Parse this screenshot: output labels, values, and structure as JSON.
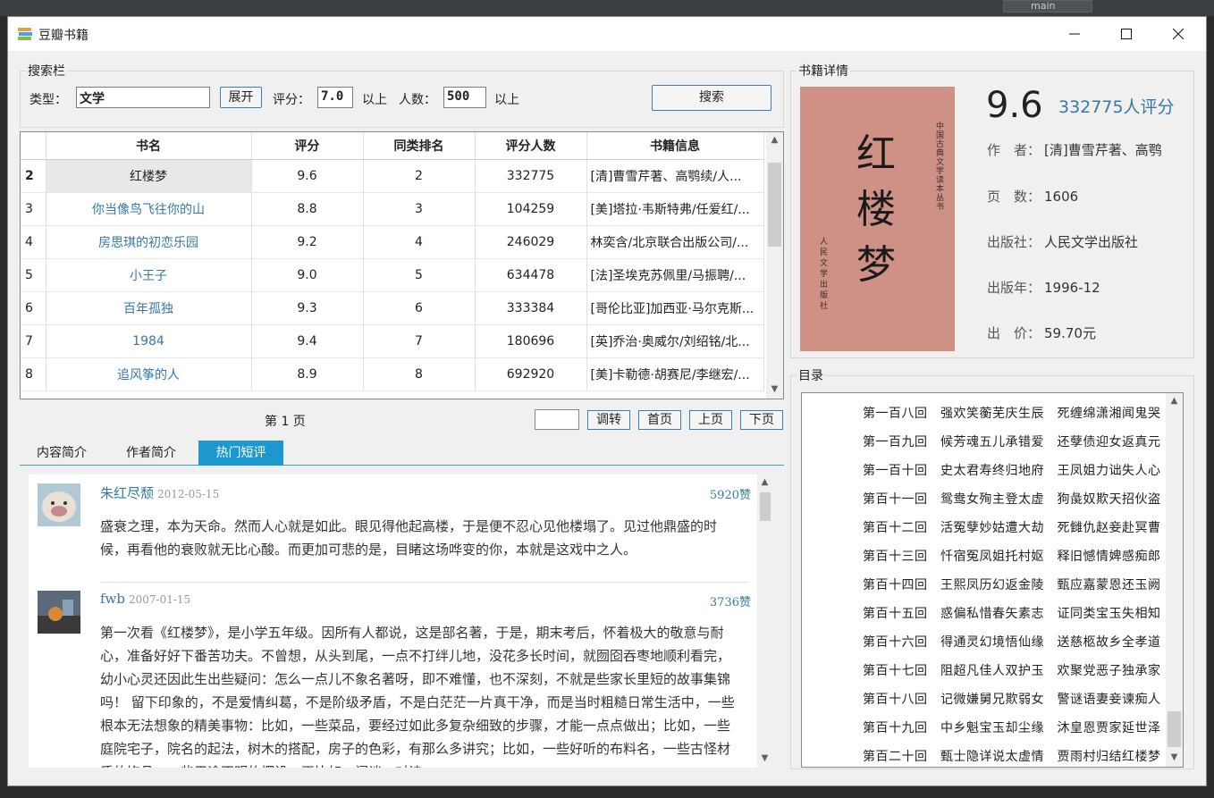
{
  "window": {
    "title": "豆瓣书籍",
    "min_icon": "minimize-icon",
    "max_icon": "maximize-icon",
    "close_icon": "close-icon"
  },
  "ide": {
    "branch": "main"
  },
  "search": {
    "group_title": "搜索栏",
    "type_label": "类型：",
    "type_value": "文学",
    "expand_button": "展开",
    "rating_label": "评分：",
    "rating_value": "7.0",
    "above1": "以上",
    "count_label": "人数：",
    "count_value": "500",
    "above2": "以上",
    "search_button": "搜索"
  },
  "table": {
    "headers": [
      "书名",
      "评分",
      "同类排名",
      "评分人数",
      "书籍信息"
    ],
    "rows": [
      {
        "n": "2",
        "name": "红楼梦",
        "score": "9.6",
        "rank": "2",
        "count": "332775",
        "info": "[清]曹雪芹著、高鹗续/人..."
      },
      {
        "n": "3",
        "name": "你当像鸟飞往你的山",
        "score": "8.8",
        "rank": "3",
        "count": "104259",
        "info": "[美]塔拉·韦斯特弗/任爱红/..."
      },
      {
        "n": "4",
        "name": "房思琪的初恋乐园",
        "score": "9.2",
        "rank": "4",
        "count": "246029",
        "info": "林奕含/北京联合出版公司/..."
      },
      {
        "n": "5",
        "name": "小王子",
        "score": "9.0",
        "rank": "5",
        "count": "634478",
        "info": "[法]圣埃克苏佩里/马振聘/..."
      },
      {
        "n": "6",
        "name": "百年孤独",
        "score": "9.3",
        "rank": "6",
        "count": "333384",
        "info": "[哥伦比亚]加西亚·马尔克斯..."
      },
      {
        "n": "7",
        "name": "1984",
        "score": "9.4",
        "rank": "7",
        "count": "180696",
        "info": "[英]乔治·奥威尔/刘绍铭/北..."
      },
      {
        "n": "8",
        "name": "追风筝的人",
        "score": "8.9",
        "rank": "8",
        "count": "692920",
        "info": "[美]卡勒德·胡赛尼/李继宏/..."
      }
    ]
  },
  "pager": {
    "text": "第 1 页",
    "jump": "调转",
    "first": "首页",
    "prev": "上页",
    "next": "下页"
  },
  "tabs": [
    "内容简介",
    "作者简介",
    "热门短评"
  ],
  "comments": [
    {
      "user": "朱红尽颓",
      "date": "2012-05-15",
      "likes": "5920赞",
      "text": "盛衰之理，本为天命。然而人心就是如此。眼见得他起高楼，于是便不忍心见他楼塌了。见过他鼎盛的时候，再看他的衰败就无比心酸。而更加可悲的是，目睹这场哗变的你，本就是这戏中之人。"
    },
    {
      "user": "fwb",
      "date": "2007-01-15",
      "likes": "3736赞",
      "text": "第一次看《红楼梦》，是小学五年级。因所有人都说，这是部名著，于是，期末考后，怀着极大的敬意与耐心，准备好好下番苦功夫。不曾想，从头到尾，一点不打绊儿地，没花多长时间，就囫囵吞枣地顺利看完，幼小心灵还因此生出些疑问：怎么一点儿不象名著呀，即不难懂，也不深刻，不就是些家长里短的故事集锦吗！ 留下印象的，不是爱情纠葛，不是阶级矛盾，不是白茫茫一片真干净，而是当时粗糙日常生活中，一些根本无法想象的精美事物：比如，一些菜品，要经过如此多复杂细致的步骤，才能一点点做出；比如，一些庭院宅子，院名的起法，树木的搭配，房子的色彩，有那么多讲究；比如，一些好听的布料名，一些古怪材质的饰品，一些用途不明的摆设；再比如，闲谈，对诗，"
    }
  ],
  "detail": {
    "group_title": "书籍详情",
    "score": "9.6",
    "raters": "332775人评分",
    "author_label": "作　者：",
    "author": "[清]曹雪芹著、高鹗",
    "pages_label": "页　数：",
    "pages": "1606",
    "publisher_label": "出版社：",
    "publisher": "人民文学出版社",
    "year_label": "出版年：",
    "year": "1996-12",
    "price_label": "出　价：",
    "price": "59.70元"
  },
  "cover": {
    "title": "红楼梦",
    "series": "中国古典文学读本丛书",
    "publisher": "人民文学出版社"
  },
  "toc": {
    "group_title": "目录",
    "items": [
      "第一百八回　强欢笑蘅芜庆生辰　死缠绵潇湘闻鬼哭",
      "第一百九回　候芳魂五儿承错爱　还孽债迎女返真元",
      "第一百十回　史太君寿终归地府　王凤姐力诎失人心",
      "第百十一回　鸳鸯女殉主登太虚　狗彘奴欺天招伙盗",
      "第百十二回　活冤孽妙姑遭大劫　死雠仇赵妾赴冥曹",
      "第百十三回　忏宿冤凤姐托村妪　释旧憾情婢感痴郎",
      "第百十四回　王熙凤历幻返金陵　甄应嘉蒙恩还玉阙",
      "第百十五回　惑偏私惜春矢素志　证同类宝玉失相知",
      "第百十六回　得通灵幻境悟仙缘　送慈柩故乡全孝道",
      "第百十七回　阻超凡佳人双护玉　欢聚党恶子独承家",
      "第百十八回　记微嫌舅兄欺弱女　警谜语妻妾谏痴人",
      "第百十九回　中乡魁宝玉却尘缘　沐皇恩贾家延世泽",
      "第百二十回　甄士隐详说太虚情　贾雨村归结红楼梦"
    ]
  }
}
